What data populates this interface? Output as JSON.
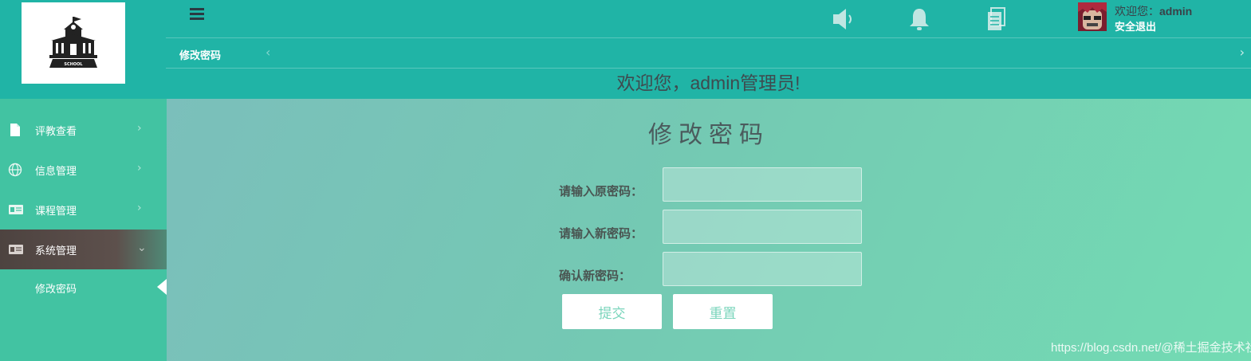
{
  "header": {
    "logo_text": "SCHOOL",
    "user_greeting_prefix": "欢迎您：",
    "username": "admin",
    "logout_label": "安全退出",
    "icons": [
      "menu-icon",
      "speaker-icon",
      "bell-icon",
      "document-icon"
    ]
  },
  "tabs": {
    "active_label": "修改密码",
    "prev_glyph": "‹",
    "next_glyph": "›"
  },
  "banner": {
    "text": "欢迎您，admin管理员!"
  },
  "sidebar": {
    "items": [
      {
        "label": "评教查看",
        "icon": "file-icon",
        "arrow": "›"
      },
      {
        "label": "信息管理",
        "icon": "globe-icon",
        "arrow": "›"
      },
      {
        "label": "课程管理",
        "icon": "id-card-icon",
        "arrow": "›"
      },
      {
        "label": "系统管理",
        "icon": "id-card-icon",
        "arrow": "⌄"
      }
    ],
    "sub_items": [
      {
        "label": "修改密码"
      }
    ]
  },
  "main": {
    "title": "修改密码",
    "fields": [
      {
        "label": "请输入原密码：",
        "value": "",
        "placeholder": ""
      },
      {
        "label": "请输入新密码：",
        "value": "",
        "placeholder": ""
      },
      {
        "label": "确认新密码：",
        "value": "",
        "placeholder": ""
      }
    ],
    "submit_label": "提交",
    "reset_label": "重置"
  },
  "watermark": "https://blog.csdn.net/@稀土掘金技术社区",
  "colors": {
    "header_bg": "#20b4a6",
    "sidebar_bg": "#42c3a2",
    "active_item_bg": "#5d504c",
    "button_text": "#7bd5bc"
  }
}
